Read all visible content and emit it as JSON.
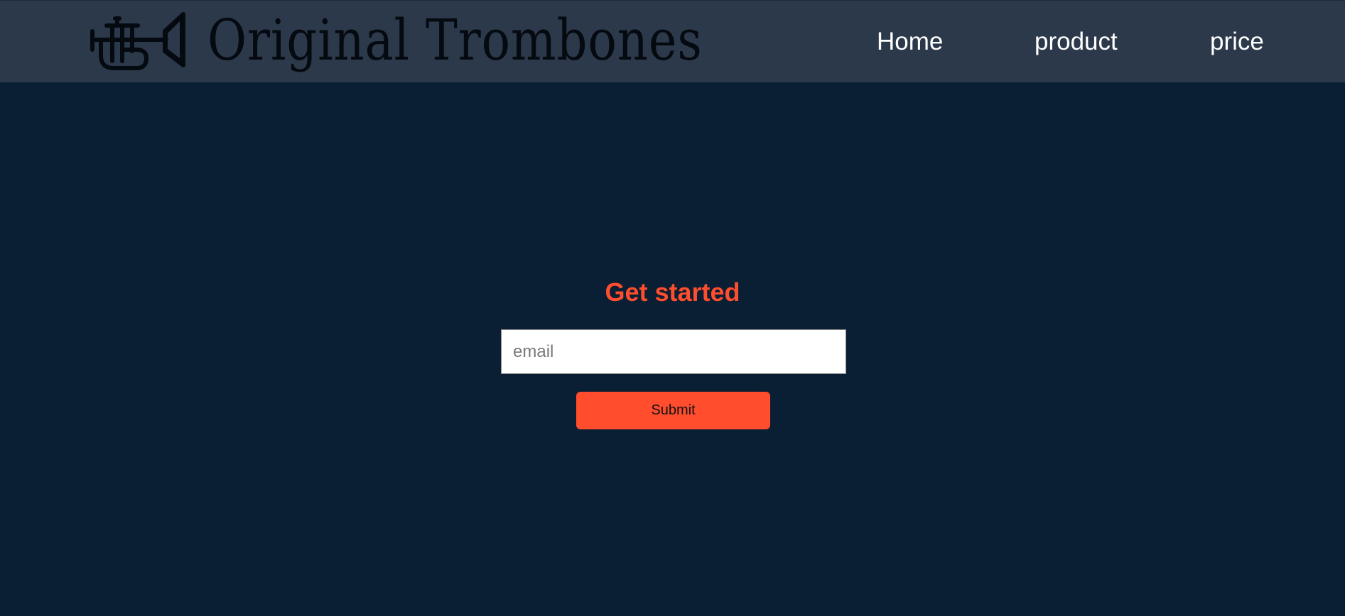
{
  "header": {
    "logo_text": "Original Trombones",
    "logo_icon": "trumpet-icon"
  },
  "nav": {
    "items": [
      {
        "label": "Home"
      },
      {
        "label": "product"
      },
      {
        "label": "price"
      }
    ]
  },
  "hero": {
    "title": "Get started",
    "email_placeholder": "email",
    "email_value": "",
    "submit_label": "Submit"
  },
  "colors": {
    "header_bg": "#2c394b",
    "page_bg": "#0a1f33",
    "accent": "#ff4d2e",
    "nav_text": "#ffffff"
  }
}
